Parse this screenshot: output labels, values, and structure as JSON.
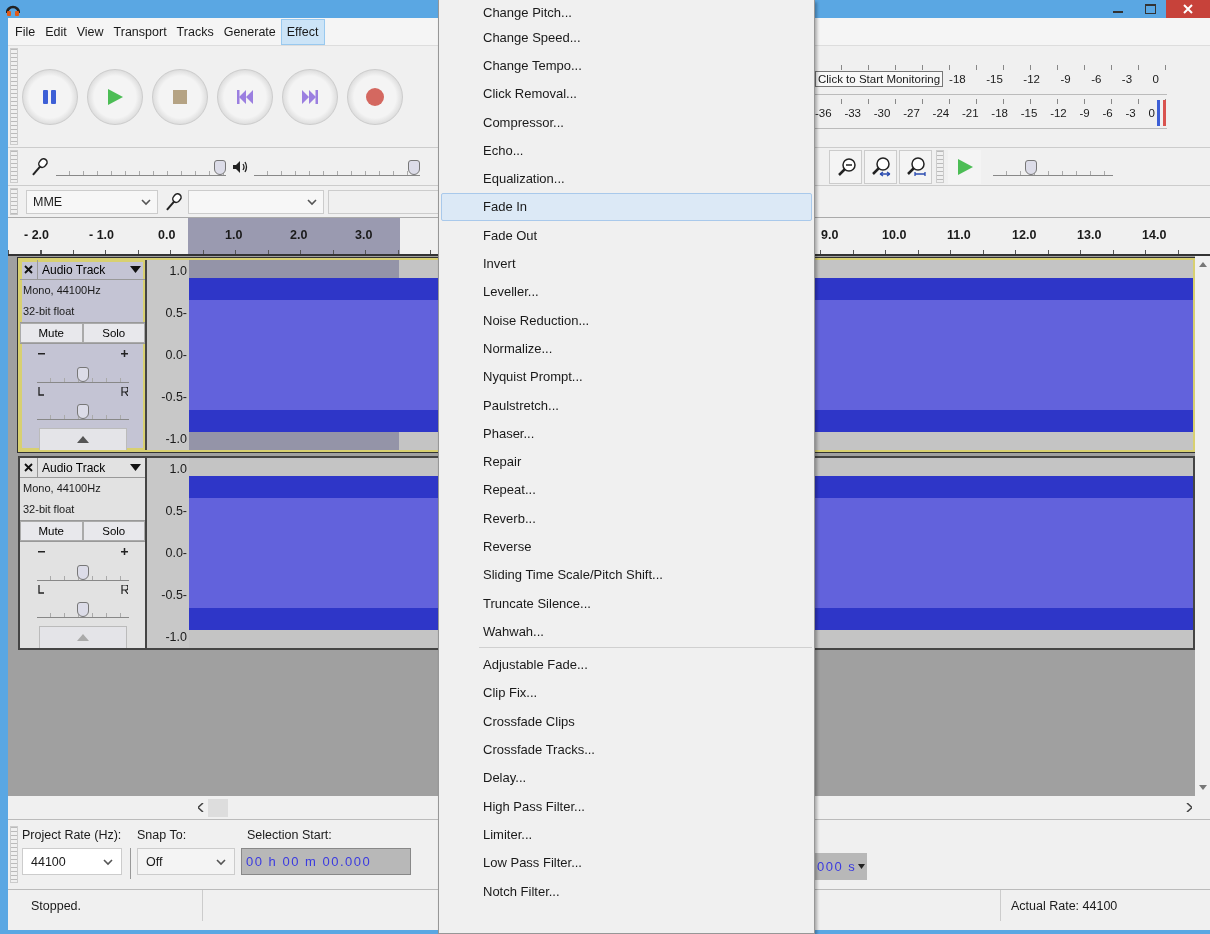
{
  "menu_bar": [
    {
      "label": "File",
      "selected": false
    },
    {
      "label": "Edit",
      "selected": false
    },
    {
      "label": "View",
      "selected": false
    },
    {
      "label": "Transport",
      "selected": false
    },
    {
      "label": "Tracks",
      "selected": false
    },
    {
      "label": "Generate",
      "selected": false
    },
    {
      "label": "Effect",
      "selected": true
    }
  ],
  "meters": {
    "tooltip": "Click to Start Monitoring",
    "record_scale": [
      "-18",
      "-15",
      "-12",
      "-9",
      "-6",
      "-3",
      "0"
    ],
    "play_scale": [
      "-36",
      "-33",
      "-30",
      "-27",
      "-24",
      "-21",
      "-18",
      "-15",
      "-12",
      "-9",
      "-6",
      "-3",
      "0"
    ]
  },
  "mixer": {
    "record_volume": {
      "level": 1
    },
    "playback_volume": {
      "level": 1
    }
  },
  "device": {
    "host": "MME"
  },
  "play_at_speed": {
    "level": 0.3
  },
  "ruler": {
    "left_labels": [
      "- 2.0",
      "- 1.0",
      "0.0",
      "1.0",
      "2.0",
      "3.0"
    ],
    "right_labels": [
      "9.0",
      "10.0",
      "11.0",
      "12.0",
      "13.0",
      "14.0"
    ]
  },
  "tracks": [
    {
      "name": "Audio Track",
      "format": "Mono, 44100Hz",
      "bit_depth": "32-bit float",
      "mute": "Mute",
      "solo": "Solo",
      "gain": {
        "level": 0.5
      },
      "pan": {
        "level": 0.5
      },
      "selected": true,
      "scale": [
        "1.0",
        "0.5-",
        "0.0-",
        "-0.5-",
        "-1.0"
      ]
    },
    {
      "name": "Audio Track",
      "format": "Mono, 44100Hz",
      "bit_depth": "32-bit float",
      "mute": "Mute",
      "solo": "Solo",
      "gain": {
        "level": 0.5
      },
      "pan": {
        "level": 0.5
      },
      "selected": false,
      "scale": [
        "1.0",
        "0.5-",
        "0.0-",
        "-0.5-",
        "-1.0"
      ]
    }
  ],
  "effect_menu": [
    {
      "kind": "item",
      "label": "Change Pitch...",
      "selected": false
    },
    {
      "kind": "item",
      "label": "Change Speed...",
      "selected": false
    },
    {
      "kind": "item",
      "label": "Change Tempo...",
      "selected": false
    },
    {
      "kind": "item",
      "label": "Click Removal...",
      "selected": false
    },
    {
      "kind": "item",
      "label": "Compressor...",
      "selected": false
    },
    {
      "kind": "item",
      "label": "Echo...",
      "selected": false
    },
    {
      "kind": "item",
      "label": "Equalization...",
      "selected": false
    },
    {
      "kind": "item",
      "label": "Fade In",
      "selected": true
    },
    {
      "kind": "item",
      "label": "Fade Out",
      "selected": false
    },
    {
      "kind": "item",
      "label": "Invert",
      "selected": false
    },
    {
      "kind": "item",
      "label": "Leveller...",
      "selected": false
    },
    {
      "kind": "item",
      "label": "Noise Reduction...",
      "selected": false
    },
    {
      "kind": "item",
      "label": "Normalize...",
      "selected": false
    },
    {
      "kind": "item",
      "label": "Nyquist Prompt...",
      "selected": false
    },
    {
      "kind": "item",
      "label": "Paulstretch...",
      "selected": false
    },
    {
      "kind": "item",
      "label": "Phaser...",
      "selected": false
    },
    {
      "kind": "item",
      "label": "Repair",
      "selected": false
    },
    {
      "kind": "item",
      "label": "Repeat...",
      "selected": false
    },
    {
      "kind": "item",
      "label": "Reverb...",
      "selected": false
    },
    {
      "kind": "item",
      "label": "Reverse",
      "selected": false
    },
    {
      "kind": "item",
      "label": "Sliding Time Scale/Pitch Shift...",
      "selected": false
    },
    {
      "kind": "item",
      "label": "Truncate Silence...",
      "selected": false
    },
    {
      "kind": "item",
      "label": "Wahwah...",
      "selected": false
    },
    {
      "kind": "separator"
    },
    {
      "kind": "item",
      "label": "Adjustable Fade...",
      "selected": false
    },
    {
      "kind": "item",
      "label": "Clip Fix...",
      "selected": false
    },
    {
      "kind": "item",
      "label": "Crossfade Clips",
      "selected": false
    },
    {
      "kind": "item",
      "label": "Crossfade Tracks...",
      "selected": false
    },
    {
      "kind": "item",
      "label": "Delay...",
      "selected": false
    },
    {
      "kind": "item",
      "label": "High Pass Filter...",
      "selected": false
    },
    {
      "kind": "item",
      "label": "Limiter...",
      "selected": false
    },
    {
      "kind": "item",
      "label": "Low Pass Filter...",
      "selected": false
    },
    {
      "kind": "item",
      "label": "Notch Filter...",
      "selected": false
    }
  ],
  "selection_toolbar": {
    "project_rate_label": "Project Rate (Hz):",
    "project_rate": "44100",
    "snap_label": "Snap To:",
    "snap": "Off",
    "selection_start_label": "Selection Start:",
    "selection_start_shown": "00 h 00 m 00.000",
    "selection_end_shown": "000 s"
  },
  "status_bar": {
    "state": "Stopped.",
    "actual_rate": "Actual Rate: 44100"
  }
}
